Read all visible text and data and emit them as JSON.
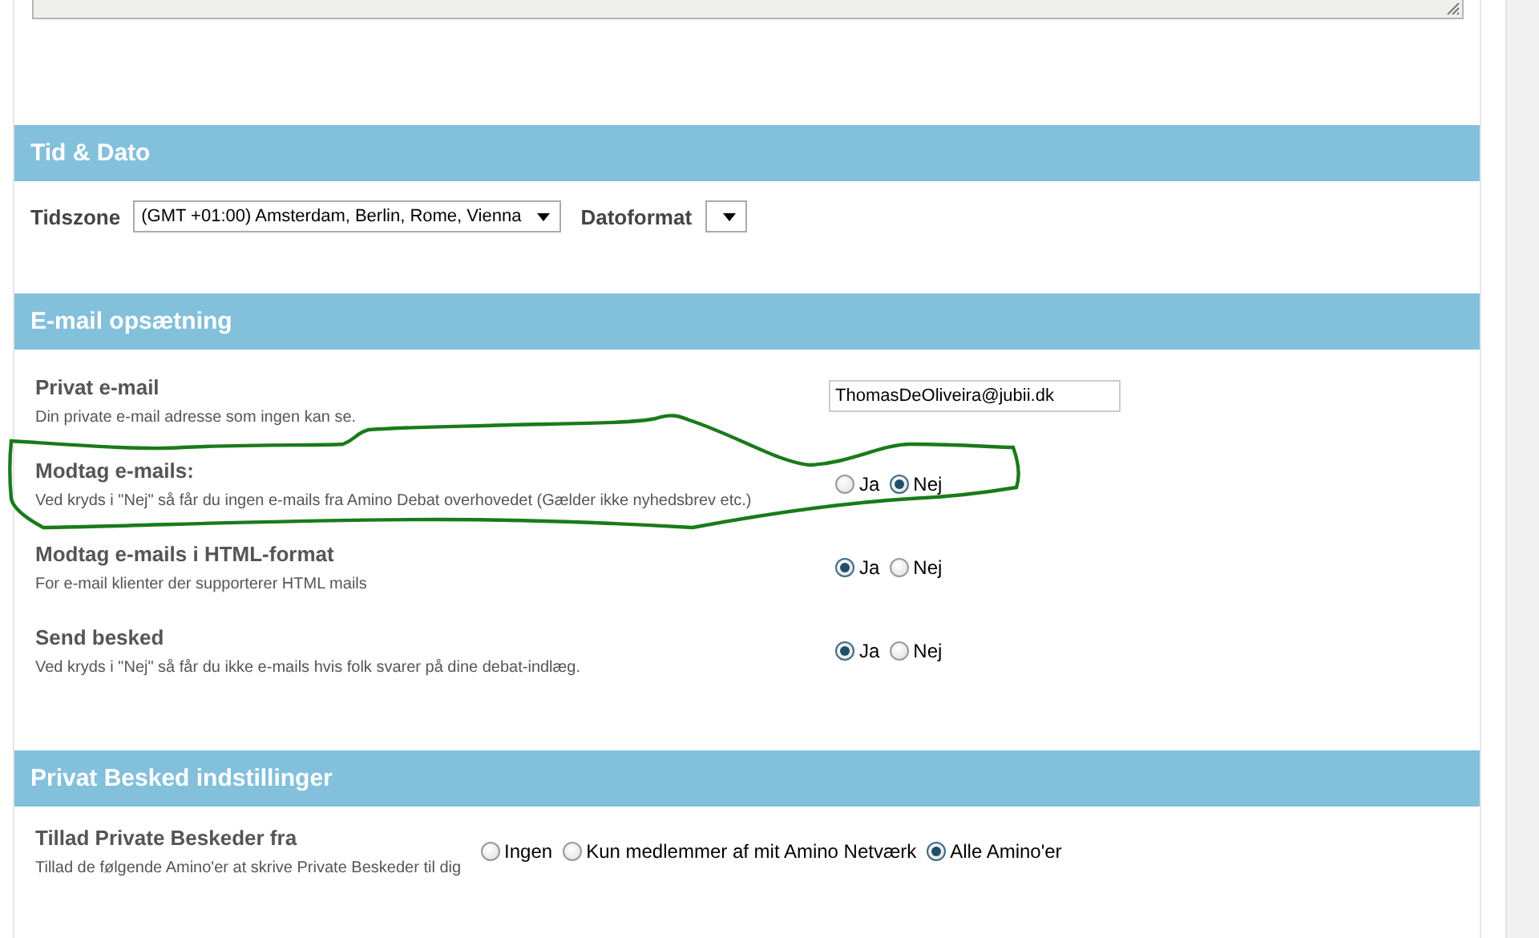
{
  "sections": [
    {
      "title": "Tid & Dato",
      "kind": "inline",
      "rows": [
        {
          "kind": "selects",
          "fields": [
            {
              "label": "Tidszone",
              "value": "(GMT +01:00) Amsterdam, Berlin, Rome, Vienna"
            },
            {
              "label": "Datoformat"
            }
          ]
        }
      ]
    },
    {
      "title": "E-mail opsætning",
      "kind": "aligned",
      "rows": [
        {
          "kind": "text",
          "title": "Privat e-mail",
          "description": "Din private e-mail adresse som ingen kan se.",
          "value": "ThomasDeOliveira@jubii.dk"
        },
        {
          "kind": "radio",
          "title": "Modtag e-mails:",
          "description": "Ved kryds i \"Nej\" så får du ingen e-mails fra Amino Debat overhovedet (Gælder ikke nyhedsbrev etc.)",
          "options": [
            {
              "label": "Ja",
              "selected": false
            },
            {
              "label": "Nej",
              "selected": true
            }
          ]
        },
        {
          "kind": "radio",
          "title": "Modtag e-mails i HTML-format",
          "description": "For e-mail klienter der supporterer HTML mails",
          "options": [
            {
              "label": "Ja",
              "selected": true
            },
            {
              "label": "Nej",
              "selected": false
            }
          ]
        },
        {
          "kind": "radio",
          "title": "Send besked",
          "description": "Ved kryds i \"Nej\" så får du ikke e-mails hvis folk svarer på dine debat-indlæg.",
          "options": [
            {
              "label": "Ja",
              "selected": true
            },
            {
              "label": "Nej",
              "selected": false
            }
          ]
        }
      ]
    },
    {
      "title": "Privat Besked indstillinger",
      "kind": "inline",
      "rows": [
        {
          "kind": "radio",
          "title": "Tillad Private Beskeder fra",
          "description": "Tillad de følgende Amino'er at skrive Private Beskeder til dig",
          "options": [
            {
              "label": "Ingen",
              "selected": false
            },
            {
              "label": "Kun medlemmer af mit Amino Netværk",
              "selected": false
            },
            {
              "label": "Alle Amino'er",
              "selected": true
            }
          ]
        }
      ]
    }
  ]
}
